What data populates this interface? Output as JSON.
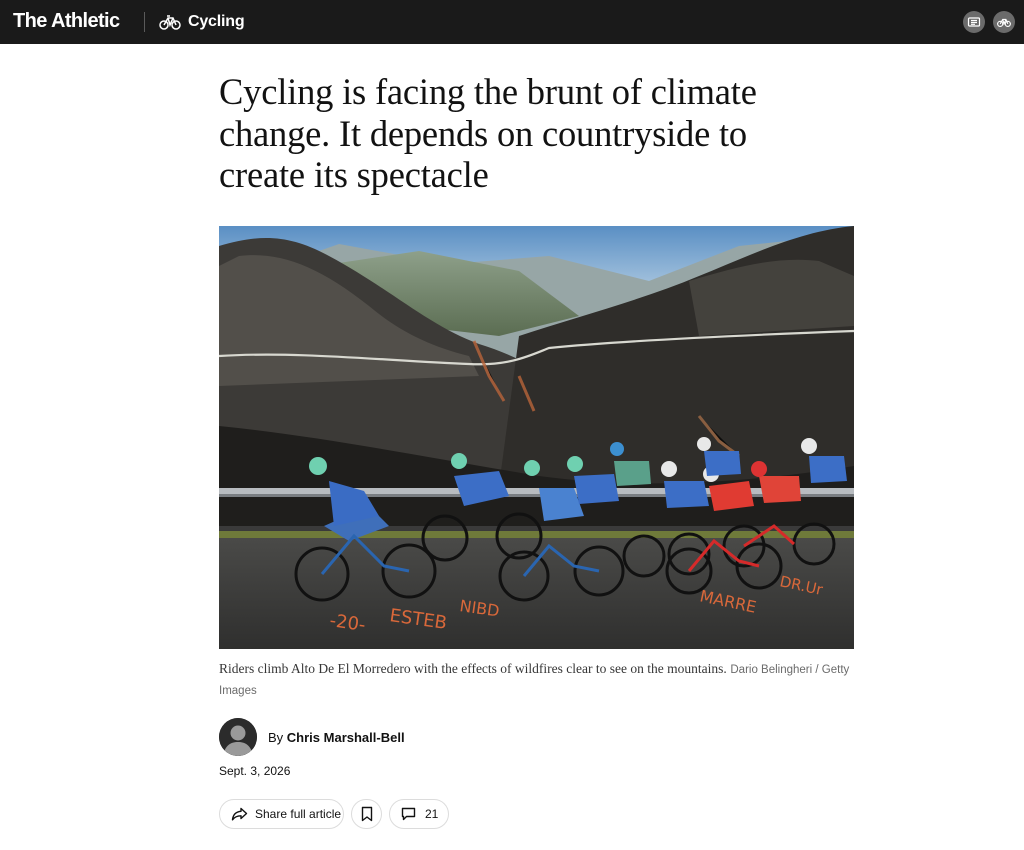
{
  "header": {
    "brand": "The Athletic",
    "section_label": "Cycling",
    "section_icon": "bicycle-icon",
    "right_icons": [
      "nyt-icon",
      "bicycle-icon"
    ],
    "background": "#1a1a1a"
  },
  "article": {
    "headline": "Cycling is facing the brunt of climate change. It depends on countryside to create its spectacle",
    "image": {
      "description_icon": "photo-image",
      "caption": "Riders climb Alto De El Morredero with the effects of wildfires clear to see on the mountains.",
      "credit": "Dario Belingheri / Getty Images"
    },
    "byline": {
      "prefix": "By",
      "author": "Chris Marshall-Bell",
      "avatar_icon": "avatar-icon"
    },
    "date": "Sept. 3, 2026",
    "actions": {
      "share_label": "Share full article",
      "share_icon": "share-arrow-icon",
      "save_icon": "bookmark-icon",
      "comments_icon": "comment-icon",
      "comments_count": "21"
    }
  }
}
